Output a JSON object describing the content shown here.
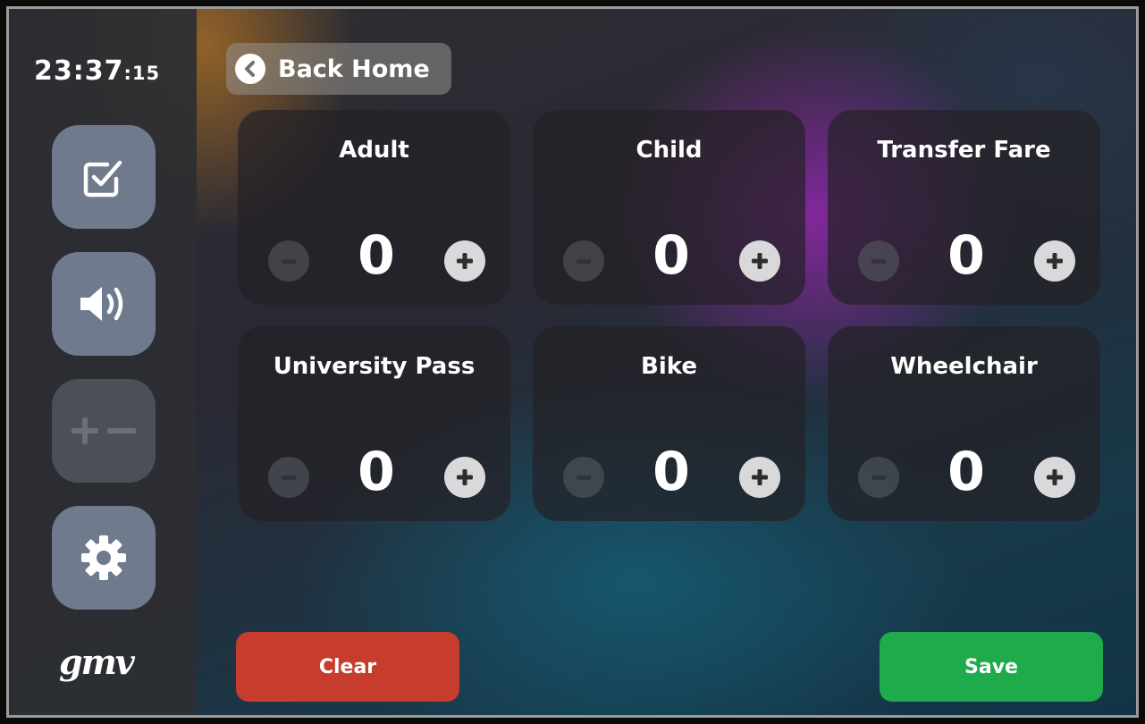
{
  "clock": {
    "hours_minutes": "23:37",
    "seconds": ":15"
  },
  "sidebar": {
    "buttons": [
      {
        "icon": "checkbox-icon",
        "state": "enabled"
      },
      {
        "icon": "speaker-icon",
        "state": "enabled"
      },
      {
        "icon": "plus-minus-icon",
        "state": "disabled"
      },
      {
        "icon": "gear-icon",
        "state": "enabled"
      }
    ],
    "logo_text": "gmv"
  },
  "header": {
    "back_label": "Back Home"
  },
  "fares": [
    {
      "label": "Adult",
      "count": "0"
    },
    {
      "label": "Child",
      "count": "0"
    },
    {
      "label": "Transfer Fare",
      "count": "0"
    },
    {
      "label": "University Pass",
      "count": "0"
    },
    {
      "label": "Bike",
      "count": "0"
    },
    {
      "label": "Wheelchair",
      "count": "0"
    }
  ],
  "actions": {
    "clear_label": "Clear",
    "save_label": "Save"
  },
  "colors": {
    "clear": "#c63c2d",
    "save": "#1faa4c",
    "sidebar_button": "#6f7a8d"
  }
}
